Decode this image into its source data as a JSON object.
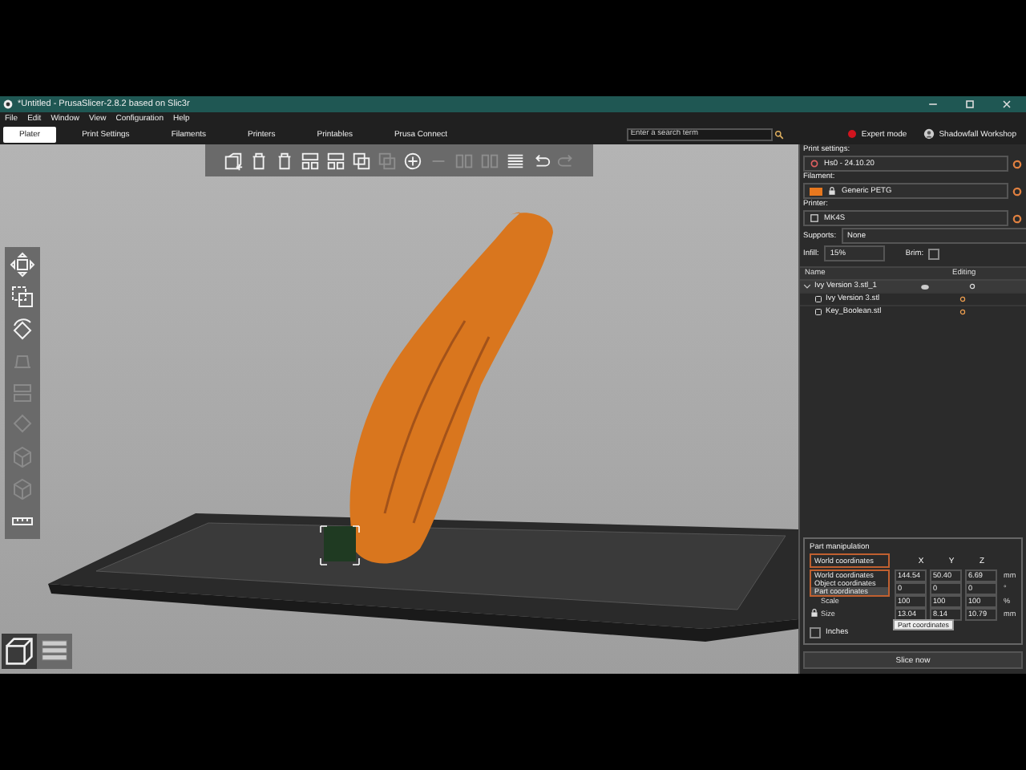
{
  "window": {
    "title": "*Untitled - PrusaSlicer-2.8.2 based on Slic3r"
  },
  "menu": [
    "File",
    "Edit",
    "Window",
    "View",
    "Configuration",
    "Help"
  ],
  "tabs": [
    {
      "label": "Plater",
      "selected": true
    },
    {
      "label": "Print Settings",
      "selected": false
    },
    {
      "label": "Filaments",
      "selected": false
    },
    {
      "label": "Printers",
      "selected": false
    },
    {
      "label": "Printables",
      "selected": false
    },
    {
      "label": "Prusa Connect",
      "selected": false
    }
  ],
  "search": {
    "placeholder": "Enter a search term"
  },
  "mode": {
    "label": "Expert mode",
    "color": "#d0141e"
  },
  "account": {
    "label": "Shadowfall Workshop"
  },
  "toolbar": [
    {
      "kind": "add",
      "disabled": false
    },
    {
      "kind": "delete",
      "disabled": false
    },
    {
      "kind": "delete_all",
      "disabled": false
    },
    {
      "kind": "arrange",
      "disabled": false
    },
    {
      "kind": "arrange_sel",
      "disabled": false
    },
    {
      "kind": "copy",
      "disabled": false
    },
    {
      "kind": "paste",
      "disabled": true
    },
    {
      "kind": "plus",
      "disabled": false
    },
    {
      "kind": "minus",
      "disabled": true
    },
    {
      "kind": "split",
      "disabled": true
    },
    {
      "kind": "split",
      "disabled": true
    },
    {
      "kind": "layers",
      "disabled": false
    },
    {
      "kind": "undo",
      "disabled": false
    },
    {
      "kind": "redo",
      "disabled": true
    }
  ],
  "gizmos": [
    {
      "kind": "move",
      "disabled": false
    },
    {
      "kind": "scale",
      "disabled": false
    },
    {
      "kind": "rotate",
      "disabled": false
    },
    {
      "kind": "place",
      "disabled": true
    },
    {
      "kind": "cut",
      "disabled": true
    },
    {
      "kind": "paint",
      "disabled": true
    },
    {
      "kind": "cube",
      "disabled": true
    },
    {
      "kind": "cube",
      "disabled": true
    },
    {
      "kind": "ruler",
      "disabled": false
    }
  ],
  "views": [
    {
      "kind": "model",
      "selected": true
    },
    {
      "kind": "preview",
      "selected": false
    }
  ],
  "sidebar": {
    "print_settings": {
      "label": "Print settings:",
      "value": "Hs0 - 24.10.20"
    },
    "filament": {
      "label": "Filament:",
      "value": "Generic PETG",
      "color": "#e8781e"
    },
    "printer": {
      "label": "Printer:",
      "value": "MK4S"
    },
    "supports": {
      "label": "Supports:",
      "value": "None"
    },
    "infill": {
      "label": "Infill:",
      "value": "15%"
    },
    "brim": {
      "label": "Brim:",
      "checked": false
    }
  },
  "object_list": {
    "columns": [
      "Name",
      "Editing"
    ],
    "items": [
      {
        "name": "Ivy Version 3.stl_1",
        "expanded": true,
        "children": [
          {
            "name": "Ivy Version 3.stl"
          },
          {
            "name": "Key_Boolean.stl"
          }
        ]
      }
    ]
  },
  "part_manipulation": {
    "title": "Part manipulation",
    "coordinates": "World coordinates",
    "options": [
      {
        "label": "World coordinates",
        "selected": false
      },
      {
        "label": "Object coordinates",
        "selected": false
      },
      {
        "label": "Part coordinates",
        "selected": true
      }
    ],
    "axes": [
      "X",
      "Y",
      "Z"
    ],
    "rows": [
      {
        "label": "",
        "values": [
          "144.54",
          "50.40",
          "6.69"
        ],
        "unit": "mm"
      },
      {
        "label": "",
        "values": [
          "0",
          "0",
          "0"
        ],
        "unit": "°"
      },
      {
        "label": "Scale",
        "values": [
          "100",
          "100",
          "100"
        ],
        "unit": "%"
      },
      {
        "label": "Size",
        "values": [
          "13.04",
          "8.14",
          "10.79"
        ],
        "unit": "mm"
      }
    ],
    "tooltip": "Part coordinates",
    "inches": {
      "label": "Inches",
      "checked": false
    }
  },
  "slice_button": "Slice now"
}
